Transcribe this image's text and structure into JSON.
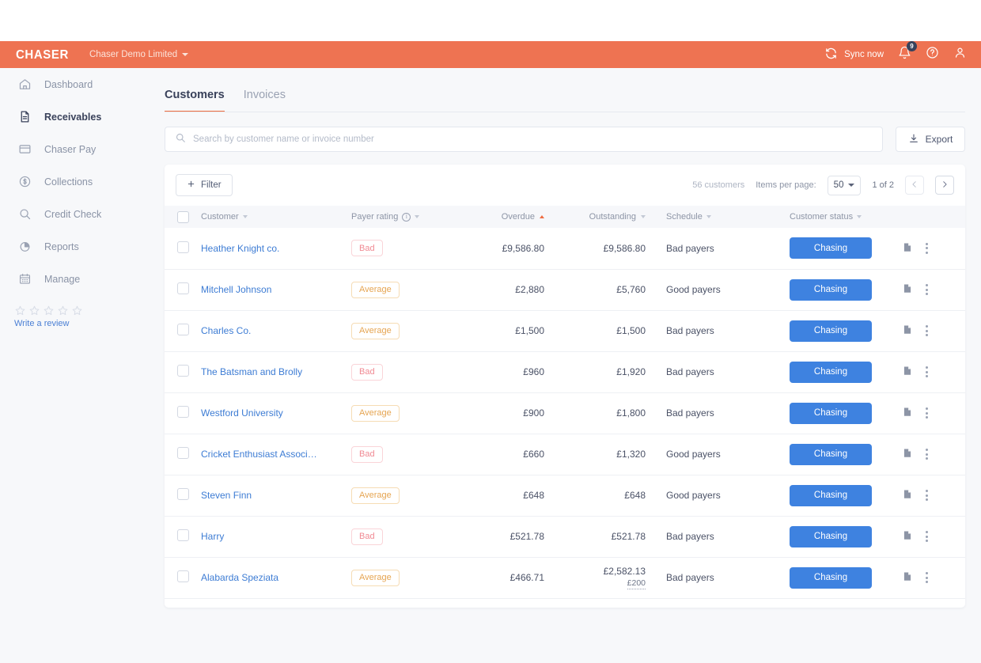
{
  "topbar": {
    "brand": "CHASER",
    "company": "Chaser Demo Limited",
    "sync_label": "Sync now",
    "notification_count": "9",
    "sync_icon": "refresh-icon",
    "bell_icon": "bell-icon",
    "help_icon": "question-circle-icon",
    "account_icon": "user-icon",
    "accent_color": "#ee7352"
  },
  "sidebar": {
    "items": [
      {
        "label": "Dashboard",
        "icon": "home-icon",
        "active": false
      },
      {
        "label": "Receivables",
        "icon": "document-icon",
        "active": true
      },
      {
        "label": "Chaser Pay",
        "icon": "credit-card-icon",
        "active": false
      },
      {
        "label": "Collections",
        "icon": "dollar-circle-icon",
        "active": false
      },
      {
        "label": "Credit Check",
        "icon": "magnifier-icon",
        "active": false
      },
      {
        "label": "Reports",
        "icon": "pie-chart-icon",
        "active": false
      },
      {
        "label": "Manage",
        "icon": "calendar-icon",
        "active": false
      }
    ],
    "review": {
      "stars": 5,
      "link_label": "Write a review"
    }
  },
  "tabs": [
    {
      "label": "Customers",
      "active": true
    },
    {
      "label": "Invoices",
      "active": false
    }
  ],
  "search": {
    "placeholder": "Search by customer name or invoice number",
    "value": "",
    "icon": "search-icon"
  },
  "export": {
    "label": "Export",
    "icon": "download-icon"
  },
  "toolbar": {
    "filter_label": "Filter",
    "filter_icon": "plus-icon",
    "customer_count": "56 customers",
    "items_per_page_label": "Items per page:",
    "items_per_page_value": "50",
    "page_indicator": "1 of 2",
    "prev_icon": "chevron-left-icon",
    "next_icon": "chevron-right-icon"
  },
  "table": {
    "columns": [
      {
        "key": "checkbox",
        "label": "",
        "sortable": false
      },
      {
        "key": "customer",
        "label": "Customer",
        "sortable": true,
        "sorted": "none"
      },
      {
        "key": "rating",
        "label": "Payer rating",
        "sortable": true,
        "sorted": "none",
        "info": true
      },
      {
        "key": "overdue",
        "label": "Overdue",
        "sortable": true,
        "sorted": "asc"
      },
      {
        "key": "outstand",
        "label": "Outstanding",
        "sortable": true,
        "sorted": "none"
      },
      {
        "key": "schedule",
        "label": "Schedule",
        "sortable": true,
        "sorted": "none"
      },
      {
        "key": "status",
        "label": "Customer status",
        "sortable": true,
        "sorted": "none"
      },
      {
        "key": "actions",
        "label": "",
        "sortable": false
      }
    ],
    "rows": [
      {
        "customer": "Heather Knight co.",
        "rating": "Bad",
        "overdue": "£9,586.80",
        "outstanding": "£9,586.80",
        "outstanding_sub": "",
        "schedule": "Bad payers",
        "status": "Chasing"
      },
      {
        "customer": "Mitchell Johnson",
        "rating": "Average",
        "overdue": "£2,880",
        "outstanding": "£5,760",
        "outstanding_sub": "",
        "schedule": "Good payers",
        "status": "Chasing"
      },
      {
        "customer": "Charles Co.",
        "rating": "Average",
        "overdue": "£1,500",
        "outstanding": "£1,500",
        "outstanding_sub": "",
        "schedule": "Bad payers",
        "status": "Chasing"
      },
      {
        "customer": "The Batsman and Brolly",
        "rating": "Bad",
        "overdue": "£960",
        "outstanding": "£1,920",
        "outstanding_sub": "",
        "schedule": "Bad payers",
        "status": "Chasing"
      },
      {
        "customer": "Westford University",
        "rating": "Average",
        "overdue": "£900",
        "outstanding": "£1,800",
        "outstanding_sub": "",
        "schedule": "Bad payers",
        "status": "Chasing"
      },
      {
        "customer": "Cricket Enthusiast Associ…",
        "rating": "Bad",
        "overdue": "£660",
        "outstanding": "£1,320",
        "outstanding_sub": "",
        "schedule": "Good payers",
        "status": "Chasing"
      },
      {
        "customer": "Steven Finn",
        "rating": "Average",
        "overdue": "£648",
        "outstanding": "£648",
        "outstanding_sub": "",
        "schedule": "Good payers",
        "status": "Chasing"
      },
      {
        "customer": "Harry",
        "rating": "Bad",
        "overdue": "£521.78",
        "outstanding": "£521.78",
        "outstanding_sub": "",
        "schedule": "Bad payers",
        "status": "Chasing"
      },
      {
        "customer": "Alabarda Speziata",
        "rating": "Average",
        "overdue": "£466.71",
        "outstanding": "£2,582.13",
        "outstanding_sub": "£200",
        "schedule": "Bad payers",
        "status": "Chasing"
      }
    ],
    "row_action_icons": [
      "note-icon",
      "kebab-menu-icon"
    ]
  },
  "colors": {
    "brand_orange": "#ee7352",
    "link_blue": "#3d7cd4",
    "button_blue": "#3e82e0",
    "bad_red": "#f08a93",
    "average_amber": "#e6a552"
  }
}
